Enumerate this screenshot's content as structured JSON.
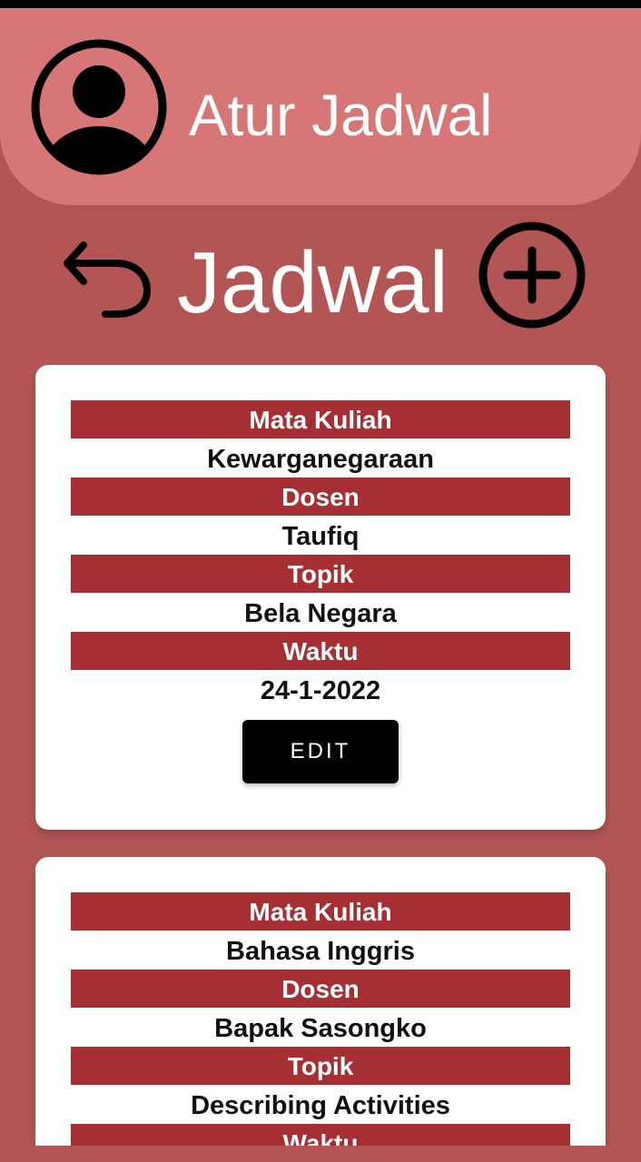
{
  "header": {
    "title": "Atur Jadwal",
    "avatar_icon": "account-circle-icon"
  },
  "toolbar": {
    "back_icon": "undo-arrow-icon",
    "title": "Jadwal",
    "add_icon": "add-circle-icon"
  },
  "colors": {
    "background": "#b45555",
    "header": "#d77676",
    "label_bar": "#a52f33",
    "card": "#ffffff",
    "button": "#000000"
  },
  "schedules": [
    {
      "course_label": "Mata Kuliah",
      "course": "Kewarganegaraan",
      "lecturer_label": "Dosen",
      "lecturer": "Taufiq",
      "topic_label": "Topik",
      "topic": "Bela Negara",
      "time_label": "Waktu",
      "time": "24-1-2022",
      "edit_label": "EDIT"
    },
    {
      "course_label": "Mata Kuliah",
      "course": "Bahasa Inggris",
      "lecturer_label": "Dosen",
      "lecturer": "Bapak Sasongko",
      "topic_label": "Topik",
      "topic": "Describing Activities",
      "time_label": "Waktu"
    }
  ]
}
